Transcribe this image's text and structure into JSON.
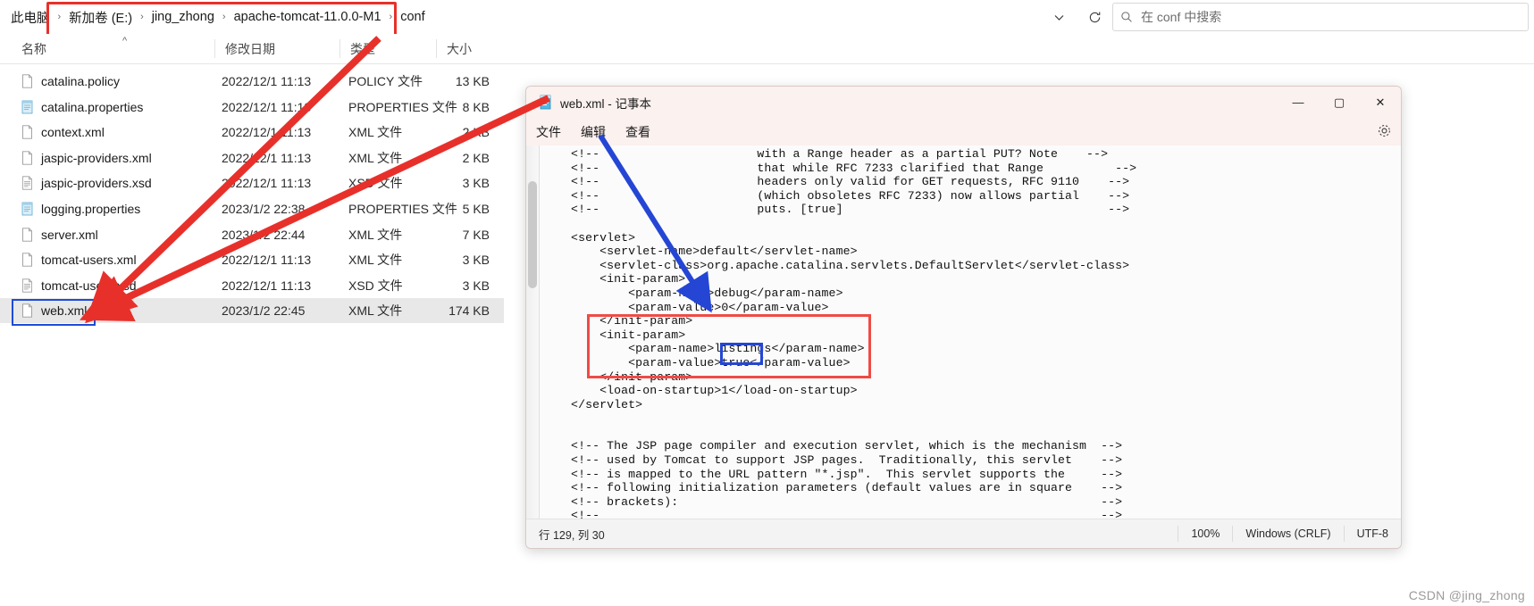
{
  "explorer": {
    "breadcrumb": {
      "root": "此电脑",
      "items": [
        "新加卷 (E:)",
        "jing_zhong",
        "apache-tomcat-11.0.0-M1",
        "conf"
      ],
      "separator": "›"
    },
    "toolbar": {
      "history_dropdown_icon": "chevron-down-icon",
      "refresh_icon": "refresh-icon"
    },
    "search": {
      "icon": "search-icon",
      "placeholder": "在 conf 中搜索"
    },
    "columns": [
      {
        "key": "name",
        "label": "名称"
      },
      {
        "key": "date",
        "label": "修改日期"
      },
      {
        "key": "type",
        "label": "类型"
      },
      {
        "key": "size",
        "label": "大小"
      }
    ],
    "sort_indicator": "^",
    "files": [
      {
        "name": "catalina.policy",
        "date": "2022/12/1 11:13",
        "type": "POLICY 文件",
        "size": "13 KB",
        "icon": "file-icon",
        "selected": false
      },
      {
        "name": "catalina.properties",
        "date": "2022/12/1 11:13",
        "type": "PROPERTIES 文件",
        "size": "8 KB",
        "icon": "notepad-file-icon",
        "selected": false
      },
      {
        "name": "context.xml",
        "date": "2022/12/1 11:13",
        "type": "XML 文件",
        "size": "2 KB",
        "icon": "file-icon",
        "selected": false
      },
      {
        "name": "jaspic-providers.xml",
        "date": "2022/12/1 11:13",
        "type": "XML 文件",
        "size": "2 KB",
        "icon": "file-icon",
        "selected": false
      },
      {
        "name": "jaspic-providers.xsd",
        "date": "2022/12/1 11:13",
        "type": "XSD 文件",
        "size": "3 KB",
        "icon": "text-file-icon",
        "selected": false
      },
      {
        "name": "logging.properties",
        "date": "2023/1/2 22:38",
        "type": "PROPERTIES 文件",
        "size": "5 KB",
        "icon": "notepad-file-icon",
        "selected": false
      },
      {
        "name": "server.xml",
        "date": "2023/1/2 22:44",
        "type": "XML 文件",
        "size": "7 KB",
        "icon": "file-icon",
        "selected": false
      },
      {
        "name": "tomcat-users.xml",
        "date": "2022/12/1 11:13",
        "type": "XML 文件",
        "size": "3 KB",
        "icon": "file-icon",
        "selected": false
      },
      {
        "name": "tomcat-users.xsd",
        "date": "2022/12/1 11:13",
        "type": "XSD 文件",
        "size": "3 KB",
        "icon": "text-file-icon",
        "selected": false
      },
      {
        "name": "web.xml",
        "date": "2023/1/2 22:45",
        "type": "XML 文件",
        "size": "174 KB",
        "icon": "file-icon",
        "selected": true
      }
    ]
  },
  "notepad": {
    "title": "web.xml - 记事本",
    "app_icon": "notepad-icon",
    "menu": [
      "文件",
      "编辑",
      "查看"
    ],
    "settings_icon": "gear-icon",
    "window_controls": {
      "minimize": "—",
      "maximize": "▢",
      "close": "✕"
    },
    "content": "    <!--                      with a Range header as a partial PUT? Note    -->\n    <!--                      that while RFC 7233 clarified that Range          -->\n    <!--                      headers only valid for GET requests, RFC 9110    -->\n    <!--                      (which obsoletes RFC 7233) now allows partial    -->\n    <!--                      puts. [true]                                     -->\n\n    <servlet>\n        <servlet-name>default</servlet-name>\n        <servlet-class>org.apache.catalina.servlets.DefaultServlet</servlet-class>\n        <init-param>\n            <param-name>debug</param-name>\n            <param-value>0</param-value>\n        </init-param>\n        <init-param>\n            <param-name>listings</param-name>\n            <param-value>true</param-value>\n        </init-param>\n        <load-on-startup>1</load-on-startup>\n    </servlet>\n\n\n    <!-- The JSP page compiler and execution servlet, which is the mechanism  -->\n    <!-- used by Tomcat to support JSP pages.  Traditionally, this servlet    -->\n    <!-- is mapped to the URL pattern \"*.jsp\".  This servlet supports the     -->\n    <!-- following initialization parameters (default values are in square    -->\n    <!-- brackets):                                                           -->\n    <!--                                                                      -->\n    <!--   checkInterval       If development is false and checkInterval is   -->\n    <!--                      greater than zero, background compilations are  -->",
    "status": {
      "position": "行 129, 列 30",
      "zoom": "100%",
      "line_ending": "Windows (CRLF)",
      "encoding": "UTF-8"
    }
  },
  "annotations": {
    "highlight_red_label": "listings-init-param-highlight",
    "highlight_blue_label": "true-value-highlight",
    "arrow_color_red": "#e8302b",
    "arrow_color_blue": "#2546d4"
  },
  "watermark": "CSDN @jing_zhong"
}
